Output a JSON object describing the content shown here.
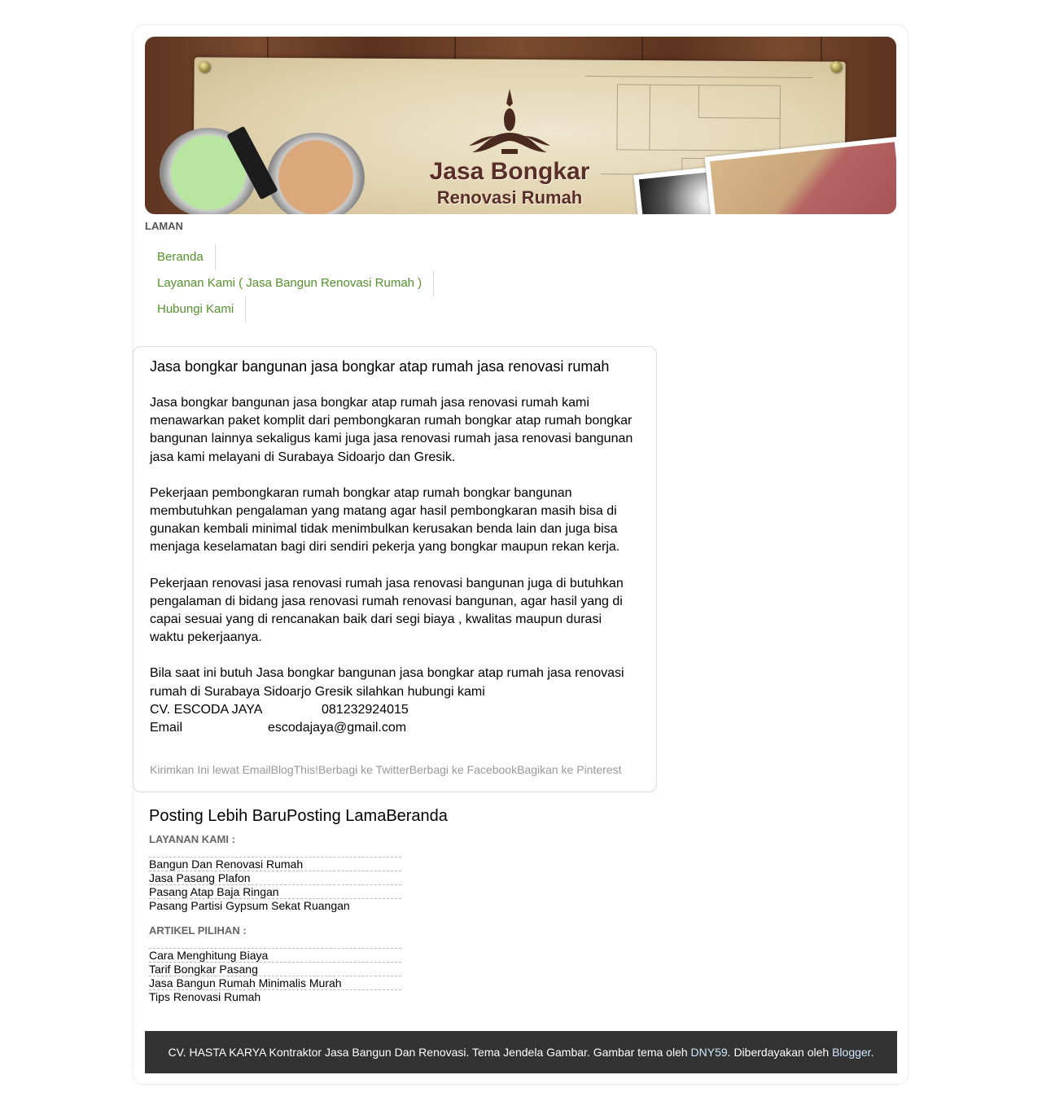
{
  "header": {
    "title": "Jasa Bongkar",
    "subtitle": "Renovasi Rumah"
  },
  "nav": {
    "heading": "LAMAN",
    "items": [
      {
        "label": "Beranda"
      },
      {
        "label": "Layanan Kami ( Jasa Bangun Renovasi Rumah )"
      },
      {
        "label": "Hubungi Kami"
      }
    ]
  },
  "post": {
    "title": "Jasa bongkar bangunan jasa bongkar atap rumah jasa renovasi rumah",
    "paragraphs": [
      "Jasa bongkar bangunan jasa bongkar atap rumah jasa renovasi rumah kami menawarkan paket komplit dari pembongkaran rumah bongkar atap rumah bongkar bangunan lainnya sekaligus kami juga jasa renovasi rumah jasa renovasi bangunan jasa kami melayani di Surabaya Sidoarjo dan Gresik.",
      "Pekerjaan pembongkaran rumah bongkar atap rumah bongkar bangunan membutuhkan pengalaman yang matang agar hasil pembongkaran masih bisa di gunakan kembali minimal tidak menimbulkan kerusakan benda lain dan juga bisa menjaga keselamatan bagi diri sendiri pekerja yang bongkar maupun rekan kerja.",
      "Pekerjaan renovasi jasa renovasi rumah jasa renovasi bangunan juga di butuhkan pengalaman di bidang jasa renovasi rumah renovasi bangunan, agar hasil yang di capai sesuai yang di rencanakan baik dari segi biaya , kwalitas maupun durasi waktu pekerjaanya.",
      "Bila saat ini butuh Jasa bongkar bangunan jasa bongkar atap rumah jasa renovasi rumah di Surabaya Sidoarjo Gresik silahkan hubungi kami"
    ],
    "contact": {
      "company": "CV. ESCODA JAYA",
      "phone": "081232924015",
      "email_label": "Email",
      "email": "escodajaya@gmail.com"
    },
    "share": [
      {
        "label": "Kirimkan Ini lewat Email"
      },
      {
        "label": "BlogThis!"
      },
      {
        "label": "Berbagi ke Twitter"
      },
      {
        "label": "Berbagi ke Facebook"
      },
      {
        "label": "Bagikan ke Pinterest"
      }
    ]
  },
  "pager": {
    "newer": "Posting Lebih Baru",
    "older": "Posting Lama",
    "home": "Beranda"
  },
  "widgets": {
    "layanan": {
      "title": "LAYANAN KAMI :",
      "items": [
        "Bangun Dan Renovasi Rumah",
        "Jasa Pasang Plafon",
        "Pasang Atap Baja Ringan",
        "Pasang Partisi Gypsum Sekat Ruangan"
      ]
    },
    "artikel": {
      "title": "ARTIKEL PILIHAN :",
      "items": [
        "Cara Menghitung Biaya",
        "Tarif Bongkar Pasang",
        "Jasa Bangun Rumah Minimalis Murah",
        "Tips Renovasi Rumah"
      ]
    }
  },
  "footer": {
    "text": "CV. HASTA KARYA Kontraktor Jasa Bangun Dan Renovasi. Tema Jendela Gambar. Gambar tema oleh ",
    "author": "DNY59",
    "powered": ". Diberdayakan oleh ",
    "blogger": "Blogger",
    "end": "."
  },
  "colors": {
    "nav_link": "#54922b",
    "footer_bg": "#333333",
    "banner_title": "#5a2e28"
  }
}
